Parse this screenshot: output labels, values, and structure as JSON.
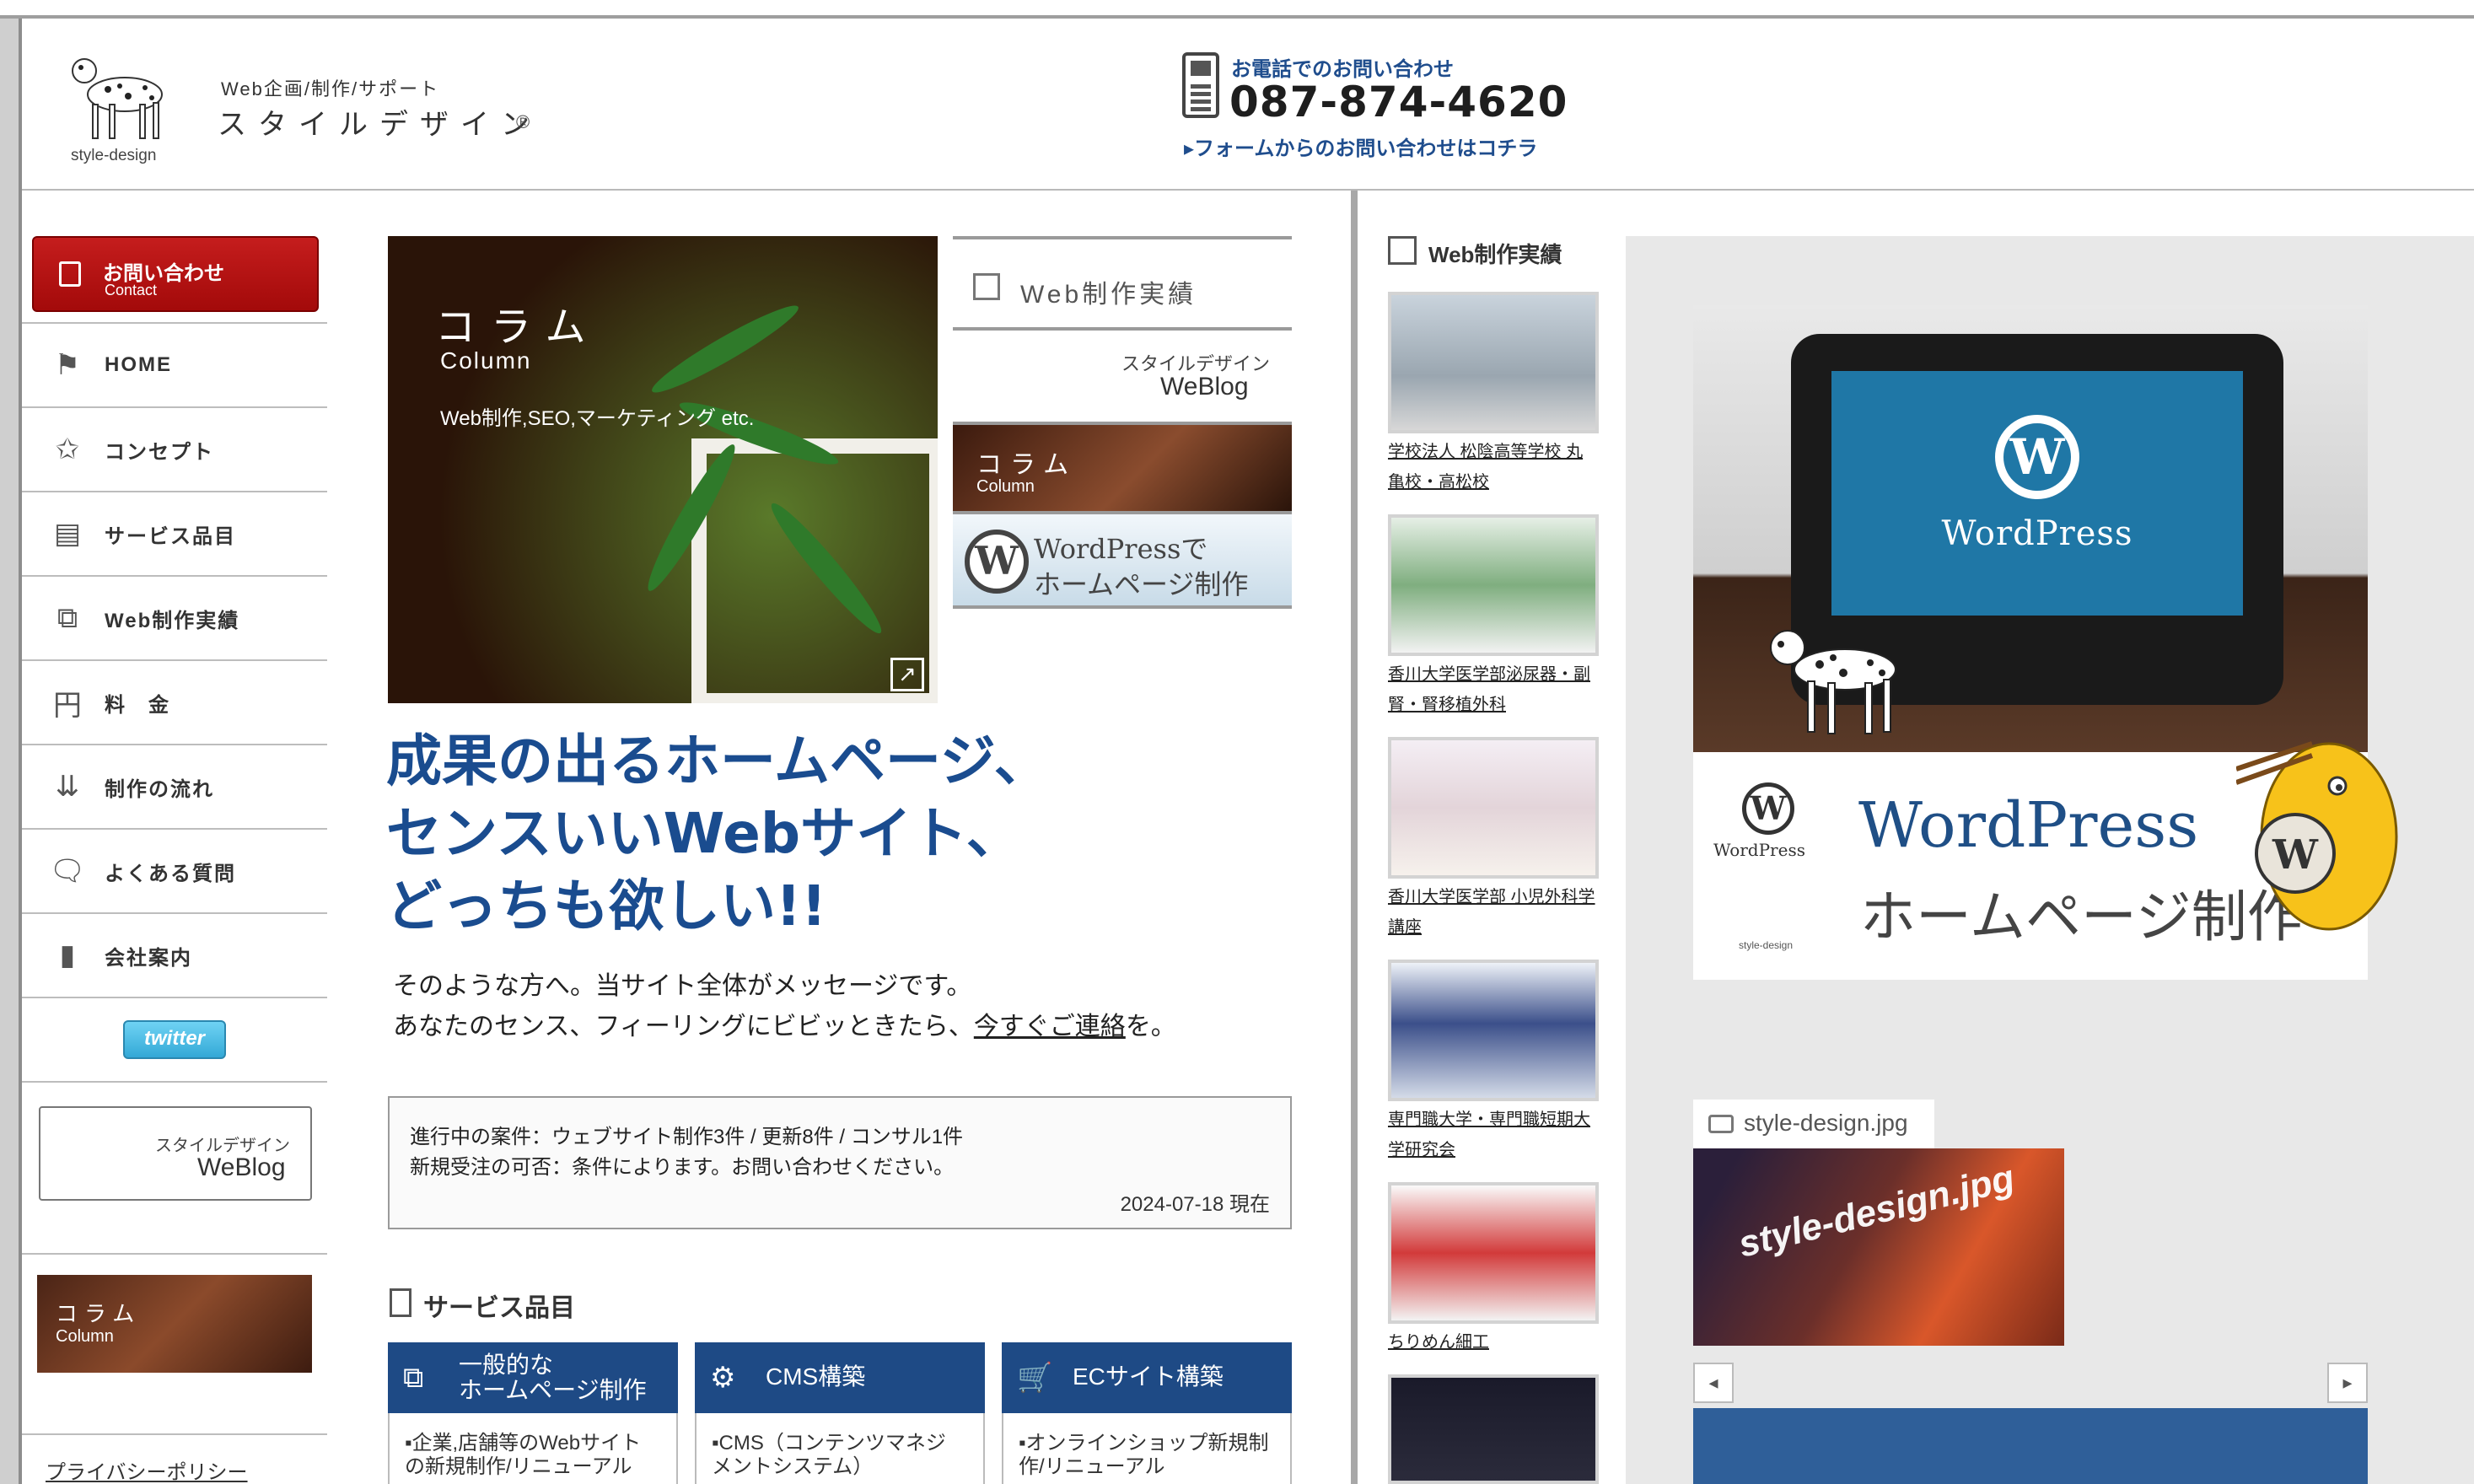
{
  "header": {
    "logo_caption": "style-design",
    "brand_small": "Web企画/制作/サポート",
    "brand_name": "スタイルデザイン",
    "brand_reg": "®",
    "tel_label": "お電話でのお問い合わせ",
    "tel_number": "087-874-4620",
    "form_link": "▸フォームからのお問い合わせはコチラ"
  },
  "nav": {
    "contact": {
      "label": "お問い合わせ",
      "sub": "Contact"
    },
    "items": [
      {
        "label": "HOME",
        "icon": "flag-icon"
      },
      {
        "label": "コンセプト",
        "icon": "star-icon"
      },
      {
        "label": "サービス品目",
        "icon": "document-icon"
      },
      {
        "label": "Web制作実績",
        "icon": "copy-icon"
      },
      {
        "label": "料　金",
        "icon": "yen-icon"
      },
      {
        "label": "制作の流れ",
        "icon": "down-arrow-icon"
      },
      {
        "label": "よくある質問",
        "icon": "speech-bubble-icon"
      },
      {
        "label": "会社案内",
        "icon": "door-icon"
      }
    ],
    "twitter": "twitter",
    "weblog": {
      "small": "スタイルデザイン",
      "big": "WeBlog"
    },
    "column": {
      "title": "コラム",
      "sub": "Column"
    },
    "privacy": "プライバシーポリシー"
  },
  "column_banner": {
    "title": "コラム",
    "sub": "Column",
    "desc": "Web制作,SEO,マーケティング etc."
  },
  "side_links": {
    "web": "Web制作実績",
    "blog_small": "スタイルデザイン",
    "blog_big": "WeBlog",
    "col_title": "コラム",
    "col_sub": "Column",
    "wp_line1": "WordPressで",
    "wp_line2": "ホームページ制作"
  },
  "headline": {
    "l1": "成果の出るホームページ、",
    "l2": "センスいいWebサイト、",
    "l3": "どっちも欲しい!!"
  },
  "lead": {
    "l1": "そのような方へ。当サイト全体がメッセージです。",
    "l2_pre": "あなたのセンス、フィーリングにビビッときたら、",
    "l2_link": "今すぐご連絡",
    "l2_post": "を。"
  },
  "status": {
    "l1": "進行中の案件：ウェブサイト制作3件 / 更新8件 / コンサル1件",
    "l2": "新規受注の可否：条件によります。お問い合わせください。",
    "date": "2024-07-18 現在"
  },
  "services": {
    "title": "サービス品目",
    "items": [
      {
        "label": "一般的な\nホームページ制作",
        "desc": "▪企業,店舗等のWebサイト\nの新規制作/リニューアル",
        "icon": "copy-icon"
      },
      {
        "label": "CMS構築",
        "desc": "▪CMS（コンテンツマネジ\nメントシステム）",
        "icon": "gear-icon"
      },
      {
        "label": "ECサイト構築",
        "desc": "▪オンラインショップ新規制\n作/リニューアル",
        "icon": "cart-icon"
      }
    ]
  },
  "works": {
    "title": "Web制作実績",
    "items": [
      {
        "caption": "学校法人 松陰高等学校 丸亀校・高松校"
      },
      {
        "caption": "香川大学医学部泌尿器・副腎・腎移植外科"
      },
      {
        "caption": "香川大学医学部 小児外科学講座"
      },
      {
        "caption": "専門職大学・専門職短期大学研究会"
      },
      {
        "caption": "ちりめん細工"
      },
      {
        "caption": ""
      }
    ]
  },
  "right_panel": {
    "screen_text": "WordPress",
    "card_logo_text": "WordPress",
    "card_small": "style-design",
    "card_big": "WordPress",
    "card_sub": "ホームページ制作",
    "photo_tab": "style-design.jpg",
    "photo_text": "style-design.jpg"
  },
  "colors": {
    "accent_blue": "#1a4c8f",
    "contact_red": "#b31212",
    "service_blue": "#1e4a85"
  }
}
